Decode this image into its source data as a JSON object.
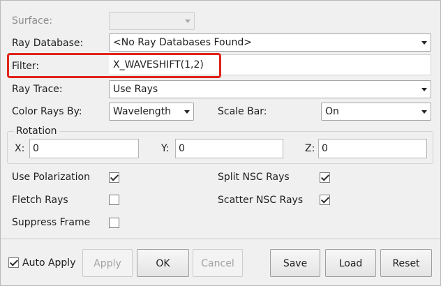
{
  "colors": {
    "highlight": "#e2231a",
    "panel": "#f0f0f0",
    "disabled_text": "#a0a0a0"
  },
  "surface": {
    "label": "Surface:",
    "value": ""
  },
  "ray_database": {
    "label": "Ray Database:",
    "value": "<No Ray Databases Found>"
  },
  "filter": {
    "label": "Filter:",
    "value": "X_WAVESHIFT(1,2)"
  },
  "ray_trace": {
    "label": "Ray Trace:",
    "value": "Use Rays"
  },
  "color_rays_by": {
    "label": "Color Rays By:",
    "value": "Wavelength"
  },
  "scale_bar": {
    "label": "Scale Bar:",
    "value": "On"
  },
  "rotation": {
    "title": "Rotation",
    "x": {
      "label": "X:",
      "value": "0"
    },
    "y": {
      "label": "Y:",
      "value": "0"
    },
    "z": {
      "label": "Z:",
      "value": "0"
    }
  },
  "options": {
    "use_polarization": {
      "label": "Use Polarization",
      "checked": true
    },
    "split_nsc_rays": {
      "label": "Split NSC Rays",
      "checked": true
    },
    "fletch_rays": {
      "label": "Fletch Rays",
      "checked": false
    },
    "scatter_nsc_rays": {
      "label": "Scatter NSC Rays",
      "checked": true
    },
    "suppress_frame": {
      "label": "Suppress Frame",
      "checked": false
    }
  },
  "footer": {
    "auto_apply": {
      "label": "Auto Apply",
      "checked": true
    },
    "apply_label": "Apply",
    "ok_label": "OK",
    "cancel_label": "Cancel",
    "save_label": "Save",
    "load_label": "Load",
    "reset_label": "Reset"
  }
}
